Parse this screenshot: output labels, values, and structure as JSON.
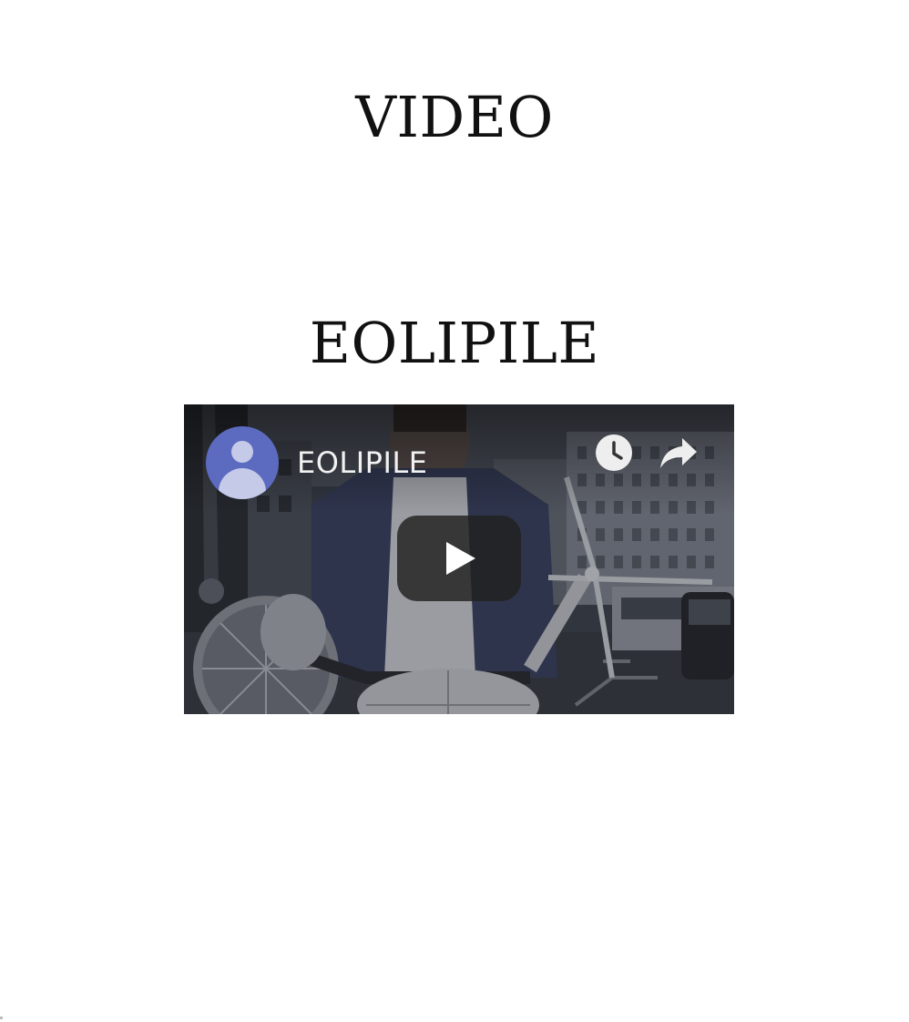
{
  "page": {
    "heading": "VIDEO"
  },
  "video_section": {
    "title": "EOLIPILE",
    "player": {
      "video_title": "EOLIPILE",
      "icons": {
        "avatar": "channel-avatar-icon",
        "watch_later": "clock-icon",
        "share": "share-arrow-icon",
        "play": "play-icon"
      },
      "colors": {
        "avatar_bg": "#5c6bc0",
        "avatar_fg": "#c5cae9",
        "play_button_bg": "#212121"
      }
    }
  }
}
